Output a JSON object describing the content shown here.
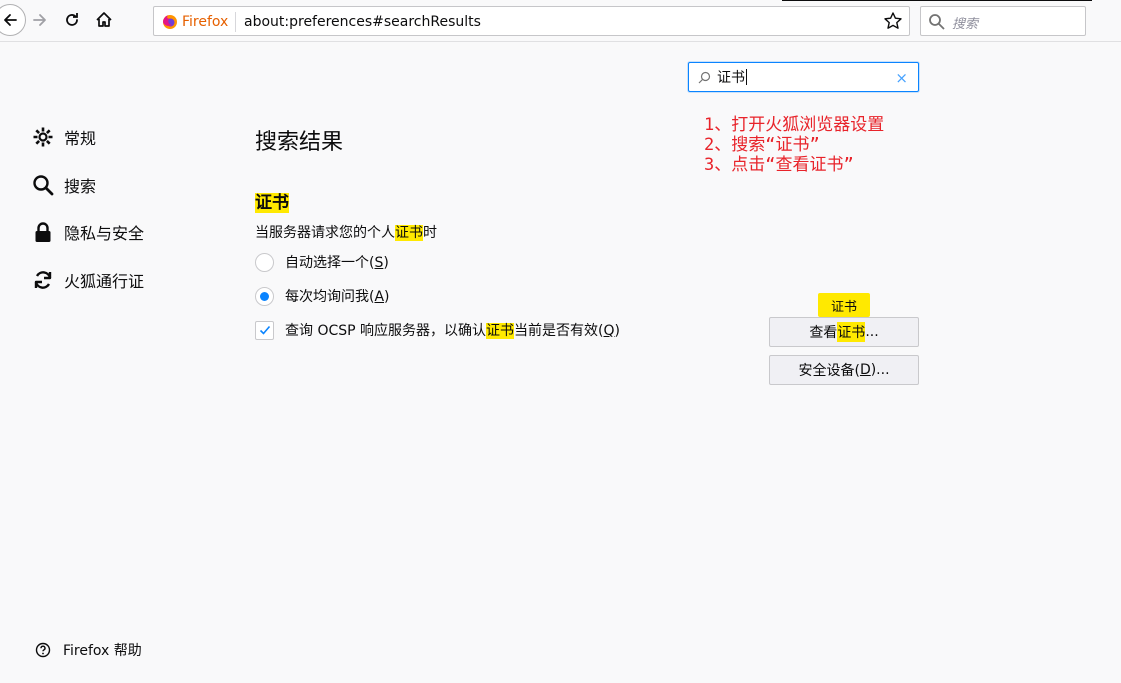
{
  "browser": {
    "identity_label": "Firefox",
    "url": "about:preferences#searchResults",
    "search_placeholder": "搜索"
  },
  "pref_search": {
    "value": "证书",
    "clear_label": "×"
  },
  "sidebar": {
    "items": [
      {
        "label": "常规",
        "icon": "gear-icon"
      },
      {
        "label": "搜索",
        "icon": "search-icon"
      },
      {
        "label": "隐私与安全",
        "icon": "lock-icon"
      },
      {
        "label": "火狐通行证",
        "icon": "sync-icon"
      }
    ],
    "help_label": "Firefox 帮助"
  },
  "content": {
    "results_title": "搜索结果",
    "section_title": "证书",
    "description": {
      "before": "当服务器请求您的个人",
      "highlight": "证书",
      "after": "时"
    },
    "radio_auto": {
      "text": "自动选择一个(",
      "key": "S",
      "end": ")",
      "checked": false
    },
    "radio_ask": {
      "text": "每次均询问我(",
      "key": "A",
      "end": ")",
      "checked": true
    },
    "ocsp": {
      "before": "查询 OCSP 响应服务器，以确认",
      "highlight": "证书",
      "after": "当前是否有效(",
      "key": "Q",
      "end": ")",
      "checked": true
    },
    "view_button": {
      "before": "查看",
      "highlight": "证书",
      "after": "..."
    },
    "security_button": {
      "before": "安全设备(",
      "key": "D",
      "after": ")..."
    },
    "tooltip": "证书"
  },
  "annotation": {
    "lines": [
      "1、打开火狐浏览器设置",
      "2、搜索“证书”",
      "3、点击“查看证书”"
    ],
    "color": "#e8232a"
  },
  "colors": {
    "accent": "#0a84ff",
    "highlight": "#ffe900",
    "firefox": "#e66000"
  }
}
